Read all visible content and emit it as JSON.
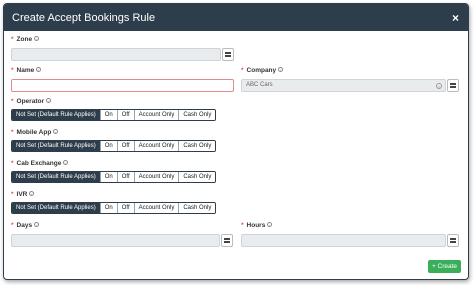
{
  "dialog": {
    "title": "Create Accept Bookings Rule",
    "close_glyph": "×"
  },
  "fields": {
    "zone_label": "Zone",
    "name_label": "Name",
    "name_value": "",
    "company_label": "Company",
    "company_value": "ABC Cars",
    "operator_label": "Operator",
    "mobile_app_label": "Mobile App",
    "cab_exchange_label": "Cab Exchange",
    "ivr_label": "IVR",
    "days_label": "Days",
    "hours_label": "Hours"
  },
  "segments": [
    "Not Set (Default Rule Applies)",
    "On",
    "Off",
    "Account Only",
    "Cash Only"
  ],
  "selected_segment": "Not Set (Default Rule Applies)",
  "required_marker": "*",
  "info_glyph": "i",
  "clear_glyph": "×",
  "create_button": {
    "label": "+ Create"
  },
  "colors": {
    "header": "#2e3d4b",
    "create": "#3bae5b",
    "required": "#d9534f",
    "error_border": "#e58a8a"
  },
  "icons": {
    "lookup": "grid-icon",
    "info": "info-icon",
    "clear": "clear-icon",
    "close": "close-icon"
  }
}
